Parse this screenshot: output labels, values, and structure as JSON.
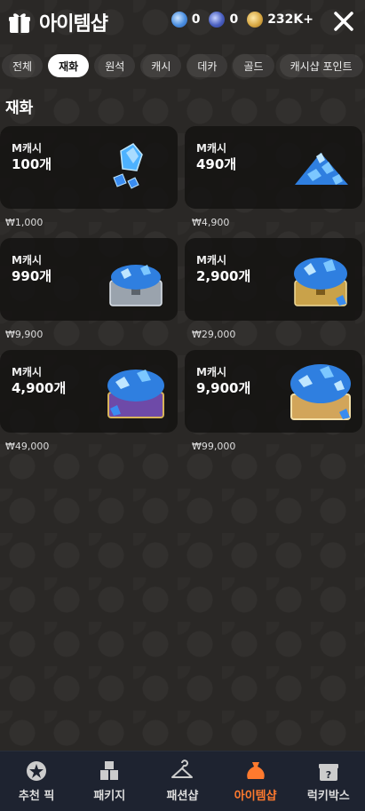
{
  "header": {
    "title": "아이템샵",
    "currencies": [
      {
        "icon": "m-cash-coin-icon",
        "value": "0"
      },
      {
        "icon": "b-cash-coin-icon",
        "value": "0"
      },
      {
        "icon": "gold-coin-icon",
        "value": "232K+"
      }
    ]
  },
  "tabs": [
    {
      "label": "전체",
      "active": false
    },
    {
      "label": "재화",
      "active": true
    },
    {
      "label": "원석",
      "active": false
    },
    {
      "label": "캐시",
      "active": false
    },
    {
      "label": "데카",
      "active": false
    },
    {
      "label": "골드",
      "active": false
    },
    {
      "label": "캐시샵 포인트",
      "active": false
    }
  ],
  "section": {
    "title": "재화"
  },
  "products": [
    {
      "label": "M캐시",
      "amount": "100개",
      "price": "₩1,000"
    },
    {
      "label": "M캐시",
      "amount": "490개",
      "price": "₩4,900"
    },
    {
      "label": "M캐시",
      "amount": "990개",
      "price": "₩9,900"
    },
    {
      "label": "M캐시",
      "amount": "2,900개",
      "price": "₩29,000"
    },
    {
      "label": "M캐시",
      "amount": "4,900개",
      "price": "₩49,000"
    },
    {
      "label": "M캐시",
      "amount": "9,900개",
      "price": "₩99,000"
    }
  ],
  "bottom_nav": [
    {
      "label": "추천 픽",
      "icon": "star-badge-icon",
      "active": false
    },
    {
      "label": "패키지",
      "icon": "boxes-icon",
      "active": false
    },
    {
      "label": "패션샵",
      "icon": "hanger-icon",
      "active": false
    },
    {
      "label": "아이템샵",
      "icon": "pouch-icon",
      "active": true
    },
    {
      "label": "럭키박스",
      "icon": "mystery-box-icon",
      "active": false
    }
  ],
  "colors": {
    "accent": "#ff7a2e",
    "nav_bg": "#1e2330",
    "gem": "#3aa0ff"
  }
}
